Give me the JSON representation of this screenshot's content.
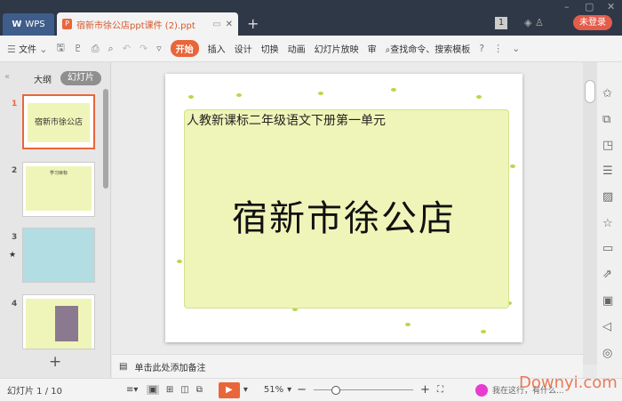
{
  "titlebar": {
    "wps_label": "WPS",
    "doc_tab": "宿新市徐公店ppt课件 (2).ppt",
    "new_tab": "+",
    "badge": "1",
    "login": "未登录"
  },
  "toolbar": {
    "file": "文件",
    "tabs": [
      "开始",
      "插入",
      "设计",
      "切换",
      "动画",
      "幻灯片放映",
      "审"
    ],
    "search": "查找命令、搜索模板",
    "help": "?"
  },
  "left": {
    "outline": "大纲",
    "slides": "幻灯片",
    "add": "+",
    "thumbs": [
      {
        "num": "1",
        "title": "宿新市徐公店"
      },
      {
        "num": "2",
        "title": "学习目标"
      },
      {
        "num": "3"
      },
      {
        "num": "4"
      }
    ]
  },
  "slide": {
    "subtitle": "人教新课标二年级语文下册第一单元",
    "title": "宿新市徐公店"
  },
  "notes": {
    "placeholder": "单击此处添加备注"
  },
  "status": {
    "slide_count": "幻灯片 1 / 10",
    "zoom": "51%",
    "minus": "−",
    "plus": "+",
    "assist": "我在这行，有什么..."
  },
  "watermark": "Downyi.com"
}
